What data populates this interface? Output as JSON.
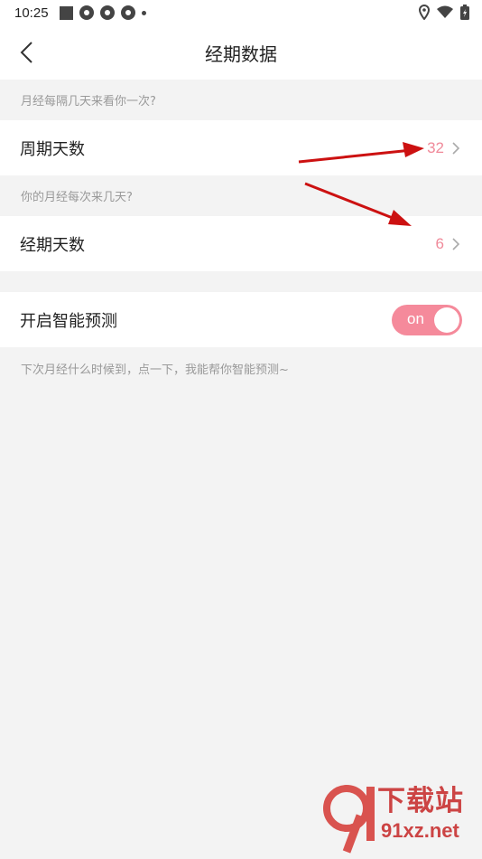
{
  "status_bar": {
    "time": "10:25"
  },
  "header": {
    "title": "经期数据"
  },
  "cycle_section": {
    "hint": "月经每隔几天来看你一次?",
    "label": "周期天数",
    "value": "32"
  },
  "period_section": {
    "hint": "你的月经每次来几天?",
    "label": "经期天数",
    "value": "6"
  },
  "prediction": {
    "label": "开启智能预测",
    "toggle_text": "on",
    "enabled": true,
    "footer": "下次月经什么时候到，点一下，我能帮你智能预测~"
  },
  "watermark": {
    "brand": "下载站",
    "url": "91xz.net"
  },
  "colors": {
    "accent": "#f58a9b",
    "arrow": "#cc1111"
  }
}
